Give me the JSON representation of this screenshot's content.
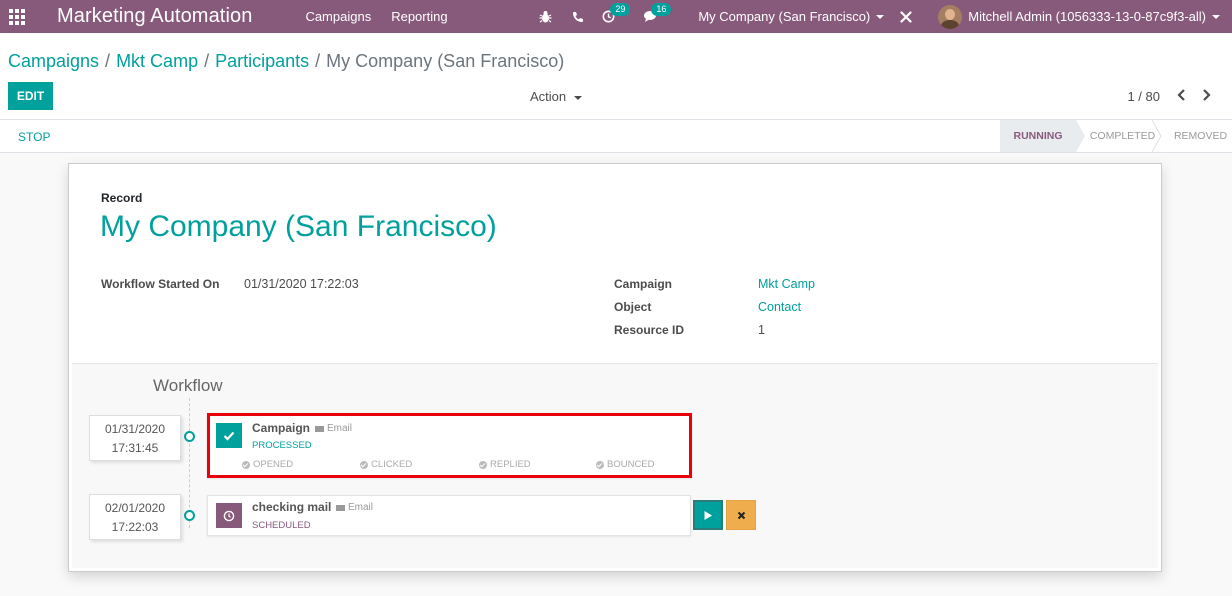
{
  "navbar": {
    "brand": "Marketing Automation",
    "menu": [
      "Campaigns",
      "Reporting"
    ],
    "activity_count": "29",
    "message_count": "16",
    "company": "My Company (San Francisco)",
    "user": "Mitchell Admin (1056333-13-0-87c9f3-all)",
    "icons": [
      "apps-icon",
      "bug-icon",
      "phone-icon",
      "clock-icon",
      "chat-icon",
      "close-icon"
    ]
  },
  "breadcrumb": {
    "items": [
      "Campaigns",
      "Mkt Camp",
      "Participants"
    ],
    "current": "My Company (San Francisco)",
    "separator": "/"
  },
  "toolbar": {
    "edit_label": "EDIT",
    "action_label": "Action",
    "pager": "1 / 80"
  },
  "statusbar": {
    "stop_label": "STOP",
    "stages": [
      "RUNNING",
      "COMPLETED",
      "REMOVED"
    ],
    "active_stage": "RUNNING"
  },
  "record": {
    "label": "Record",
    "title": "My Company (San Francisco)",
    "workflow_started_label": "Workflow Started On",
    "workflow_started_value": "01/31/2020 17:22:03",
    "campaign_label": "Campaign",
    "campaign_value": "Mkt Camp",
    "object_label": "Object",
    "object_value": "Contact",
    "resource_label": "Resource ID",
    "resource_value": "1"
  },
  "workflow": {
    "title": "Workflow",
    "activities": [
      {
        "date": "01/31/2020",
        "time": "17:31:45",
        "name": "Campaign",
        "type": "Email",
        "status": "PROCESSED",
        "metrics": [
          "OPENED",
          "CLICKED",
          "REPLIED",
          "BOUNCED"
        ]
      },
      {
        "date": "02/01/2020",
        "time": "17:22:03",
        "name": "checking mail",
        "type": "Email",
        "status": "SCHEDULED"
      }
    ]
  },
  "colors": {
    "navbar": "#875a7b",
    "accent": "#00a09d",
    "highlight": "#e8000b",
    "cancel": "#f0ad4e"
  }
}
